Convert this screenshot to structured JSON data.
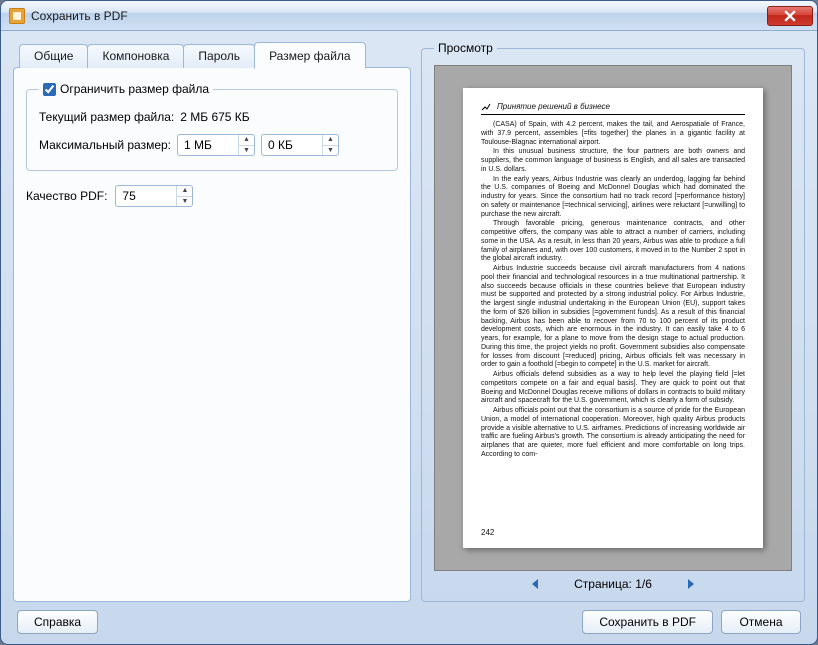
{
  "window": {
    "title": "Сохранить в PDF"
  },
  "tabs": {
    "general": "Общие",
    "layout": "Компоновка",
    "password": "Пароль",
    "filesize": "Размер файла"
  },
  "filesize_panel": {
    "limit_label": "Ограничить размер файла",
    "current_label": "Текущий размер файла:",
    "current_value": "2 МБ 675 КБ",
    "max_label": "Максимальный размер:",
    "max_mb_value": "1 МБ",
    "max_kb_value": "0 КБ",
    "quality_label": "Качество PDF:",
    "quality_value": "75"
  },
  "preview": {
    "group_label": "Просмотр",
    "page_label": "Страница:",
    "page_current": 1,
    "page_total": 6,
    "doc": {
      "title": "Принятие решений в бизнесе",
      "page_number": "242",
      "paragraphs": [
        "(CASA) of Spain, with 4.2 percent, makes the tail, and Aerospatiale of France, with 37.9 percent, assembles [=fits together] the planes in a gigantic facility at Toulouse-Blagnac international airport.",
        "In this unusual business structure, the four partners are both owners and suppliers, the common language of business is English, and all sales are transacted in U.S. dollars.",
        "In the early years, Airbus Industrie was clearly an underdog, lagging far behind the U.S. companies of Boeing and McDonnel Douglas which had dominated the industry for years. Since the consortium had no track record [=performance history] on safety or maintenance [=technical servicing], airlines were reluctant [=unwilling] to purchase the new aircraft.",
        "Through favorable pricing, generous maintenance contracts, and other competitive offers, the company was able to attract a number of carriers, including some in the USA. As a result, in less than 20 years, Airbus was able to produce a full family of airplanes and, with over 100 customers, it moved in to the Number 2 spot in the global aircraft industry.",
        "Airbus Industrie succeeds because civil aircraft manufacturers from 4 nations pool their financial and technological resources in a true multinational partnership. It also succeeds because officials in these countries believe that European industry must be supported and protected by a strong industrial policy. For Airbus Industrie, the largest single industrial undertaking in the European Union (EU), support takes the form of $26 billion in subsidies [=government funds]. As a result of this financial backing, Airbus has been able to recover from 70 to 100 percent of its product development costs, which are enormous in the industry. It can easily take 4 to 6 years, for example, for a plane to move from the design stage to actual production. During this time, the project yields no profit. Government subsidies also compensate for losses from discount [=reduced] pricing, Airbus officials felt was necessary in order to gain a foothold [=begin to compete] in the U.S. market for aircraft.",
        "Airbus officials defend subsidies as a way to help level the playing field [=let competitors compete on a fair and equal basis]. They are quick to point out that Boeing and McDonnel Douglas receive millions of dollars in contracts to build military aircraft and spacecraft for the U.S. government, which is clearly a form of subsidy.",
        "Airbus officials point out that the consortium is a source of pride for the European Union, a model of international cooperation. Moreover, high quality Airbus products provide a visible alternative to U.S. airframes. Predictions of increasing worldwide air traffic are fueling Airbus's growth. The consortium is already anticipating the need for airplanes that are quieter, more fuel efficient and more comfortable on long trips. According to com-"
      ]
    }
  },
  "buttons": {
    "help": "Справка",
    "save": "Сохранить в PDF",
    "cancel": "Отмена"
  }
}
